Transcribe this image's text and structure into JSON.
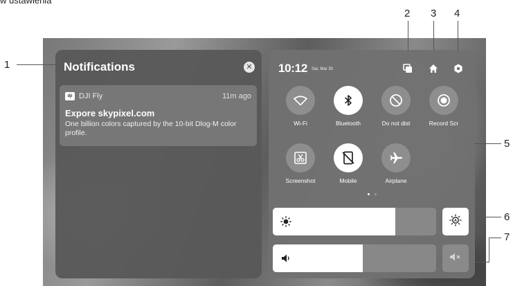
{
  "caption": "w ustawienia",
  "callouts": [
    "1",
    "2",
    "3",
    "4",
    "5",
    "6",
    "7"
  ],
  "notifications": {
    "title": "Notifications",
    "close_icon": "close-circle-icon",
    "items": [
      {
        "app_icon": "dji-logo-icon",
        "app_icon_text": "dji",
        "app_name": "DJI Fly",
        "time": "11m ago",
        "heading": "Expore skypixel.com",
        "body": "One billion colors captured by the 10-bit Dlog-M color profile."
      }
    ]
  },
  "control": {
    "time": "10:12",
    "date": "Sat, Mar 30",
    "header_icons": [
      "multitask-icon",
      "home-icon",
      "settings-hexagon-icon"
    ],
    "toggles": [
      {
        "label": "Wi-Fi",
        "icon": "wifi-icon",
        "active": false
      },
      {
        "label": "Bluetooth",
        "icon": "bluetooth-icon",
        "active": true
      },
      {
        "label": "Do not dist",
        "icon": "do-not-disturb-icon",
        "active": false
      },
      {
        "label": "Record Scr",
        "icon": "record-screen-icon",
        "active": false
      },
      {
        "label": "Screenshot",
        "icon": "screenshot-icon",
        "active": false
      },
      {
        "label": "Mobile",
        "icon": "mobile-data-off-icon",
        "active": true
      },
      {
        "label": "Airplane",
        "icon": "airplane-icon",
        "active": false
      }
    ],
    "page_dots": {
      "count": 2,
      "current": 1
    },
    "brightness": {
      "level": 0.75,
      "icon": "brightness-icon",
      "auto_icon": "auto-brightness-icon"
    },
    "volume": {
      "level": 0.55,
      "icon": "volume-icon",
      "mute_icon": "mute-icon"
    }
  },
  "colors": {
    "panel_bg": "#585858",
    "control_bg": "#707070",
    "active_toggle": "#ffffff",
    "inactive_toggle": "#8e8e8e"
  }
}
